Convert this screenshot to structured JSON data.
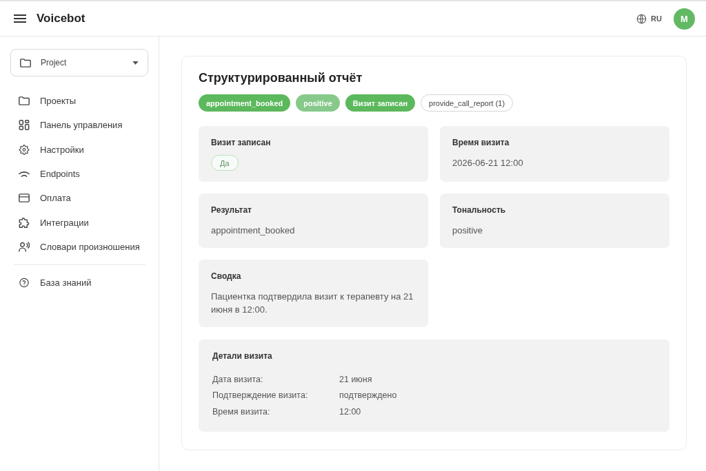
{
  "header": {
    "title": "Voicebot",
    "language": "RU",
    "avatar": "M"
  },
  "sidebar": {
    "project_select": {
      "value": "Project"
    },
    "nav_items": [
      {
        "label": "Проекты"
      },
      {
        "label": "Панель управления"
      },
      {
        "label": "Настройки"
      },
      {
        "label": "Endpoints"
      },
      {
        "label": "Оплата"
      },
      {
        "label": "Интеграции"
      },
      {
        "label": "Словари произношения"
      }
    ],
    "footer_items": [
      {
        "label": "База знаний"
      }
    ]
  },
  "report": {
    "title": "Структурированный отчёт",
    "tags": [
      {
        "label": "appointment_booked",
        "kind": "filled"
      },
      {
        "label": "positive",
        "kind": "light"
      },
      {
        "label": "Визит записан",
        "kind": "filled"
      },
      {
        "label": "provide_call_report (1)",
        "kind": "outline"
      }
    ],
    "fields": [
      {
        "label": "Визит записан",
        "kind": "chip",
        "value": "Да"
      },
      {
        "label": "Время визита",
        "kind": "text",
        "value": "2026-06-21 12:00"
      },
      {
        "label": "Результат",
        "kind": "text",
        "value": "appointment_booked"
      },
      {
        "label": "Тональность",
        "kind": "text",
        "value": "positive"
      },
      {
        "label": "Сводка",
        "kind": "text",
        "value": "Пациентка подтвердила визит к терапевту на 21 июня в 12:00."
      }
    ],
    "details": {
      "title": "Детали визита",
      "rows": [
        {
          "label": "Дата визита:",
          "value": "21 июня"
        },
        {
          "label": "Подтверждение визита:",
          "value": "подтверждено"
        },
        {
          "label": "Время визита:",
          "value": "12:00"
        }
      ]
    }
  }
}
